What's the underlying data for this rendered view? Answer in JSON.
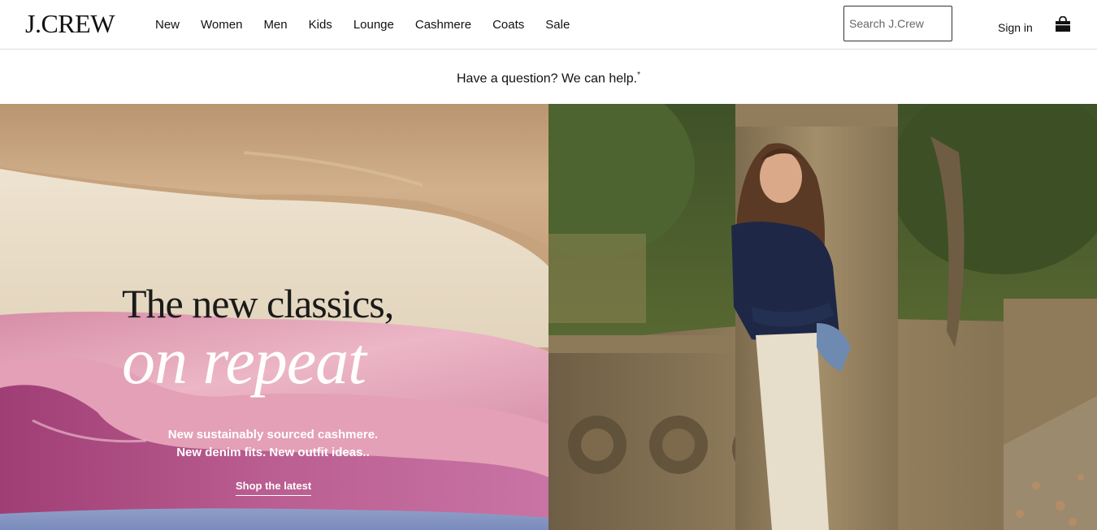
{
  "header": {
    "logo": "J.CREW",
    "nav": [
      "New",
      "Women",
      "Men",
      "Kids",
      "Lounge",
      "Cashmere",
      "Coats",
      "Sale"
    ],
    "search_placeholder": "Search J.Crew",
    "signin_label": "Sign in",
    "bag_icon": "shopping-bag-icon"
  },
  "promo": {
    "text": "Have a question? We can help.",
    "marker": "*"
  },
  "hero": {
    "headline_line1": "The new classics,",
    "headline_line2": "on repeat",
    "subtext_line1": "New sustainably sourced cashmere.",
    "subtext_line2": "New denim fits. New outfit ideas..",
    "cta_label": "Shop the latest"
  },
  "colors": {
    "camel": "#c9a47f",
    "cream": "#e8dcc8",
    "pink": "#e3a7b8",
    "magenta": "#b65a8c",
    "denim": "#8c9bc6",
    "stone": "#8a7658",
    "foliage": "#55662f"
  }
}
